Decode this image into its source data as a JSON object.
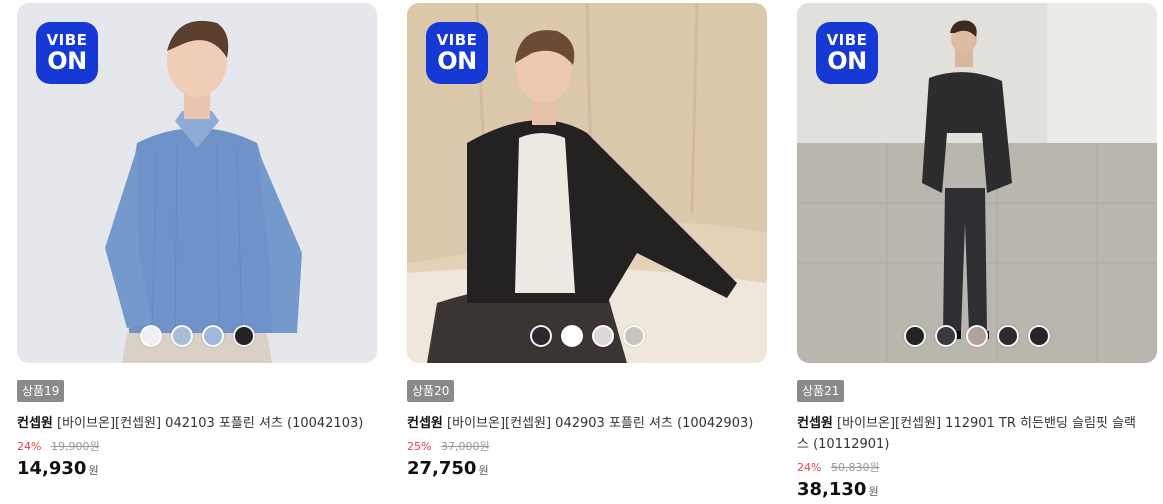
{
  "products": [
    {
      "badge": "상품19",
      "brand": "컨셉원",
      "title": "[바이브온][컨셉원] 042103 포플린 셔츠 (10042103)",
      "discount": "24%",
      "original_price": "19,900원",
      "price": "14,930",
      "currency": "원",
      "logo": {
        "line1": "VIBE",
        "line2": "ON"
      },
      "swatches": [
        "#eef0f4",
        "#a9bcd8",
        "#9fb7dc",
        "#222226"
      ]
    },
    {
      "badge": "상품20",
      "brand": "컨셉원",
      "title": "[바이브온][컨셉원] 042903 포플린 셔츠 (10042903)",
      "discount": "25%",
      "original_price": "37,000원",
      "price": "27,750",
      "currency": "원",
      "logo": {
        "line1": "VIBE",
        "line2": "ON"
      },
      "swatches": [
        "#2a2a2e",
        "#ffffff",
        "#d9d9db",
        "#c9c4bf"
      ]
    },
    {
      "badge": "상품21",
      "brand": "컨셉원",
      "title": "[바이브온][컨셉원] 112901 TR 히든밴딩 슬림핏 슬랙스 (10112901)",
      "discount": "24%",
      "original_price": "50,830원",
      "price": "38,130",
      "currency": "원",
      "logo": {
        "line1": "VIBE",
        "line2": "ON"
      },
      "swatches": [
        "#232326",
        "#3a3a3e",
        "#b0a19a",
        "#2b2b30",
        "#26262a"
      ]
    }
  ]
}
